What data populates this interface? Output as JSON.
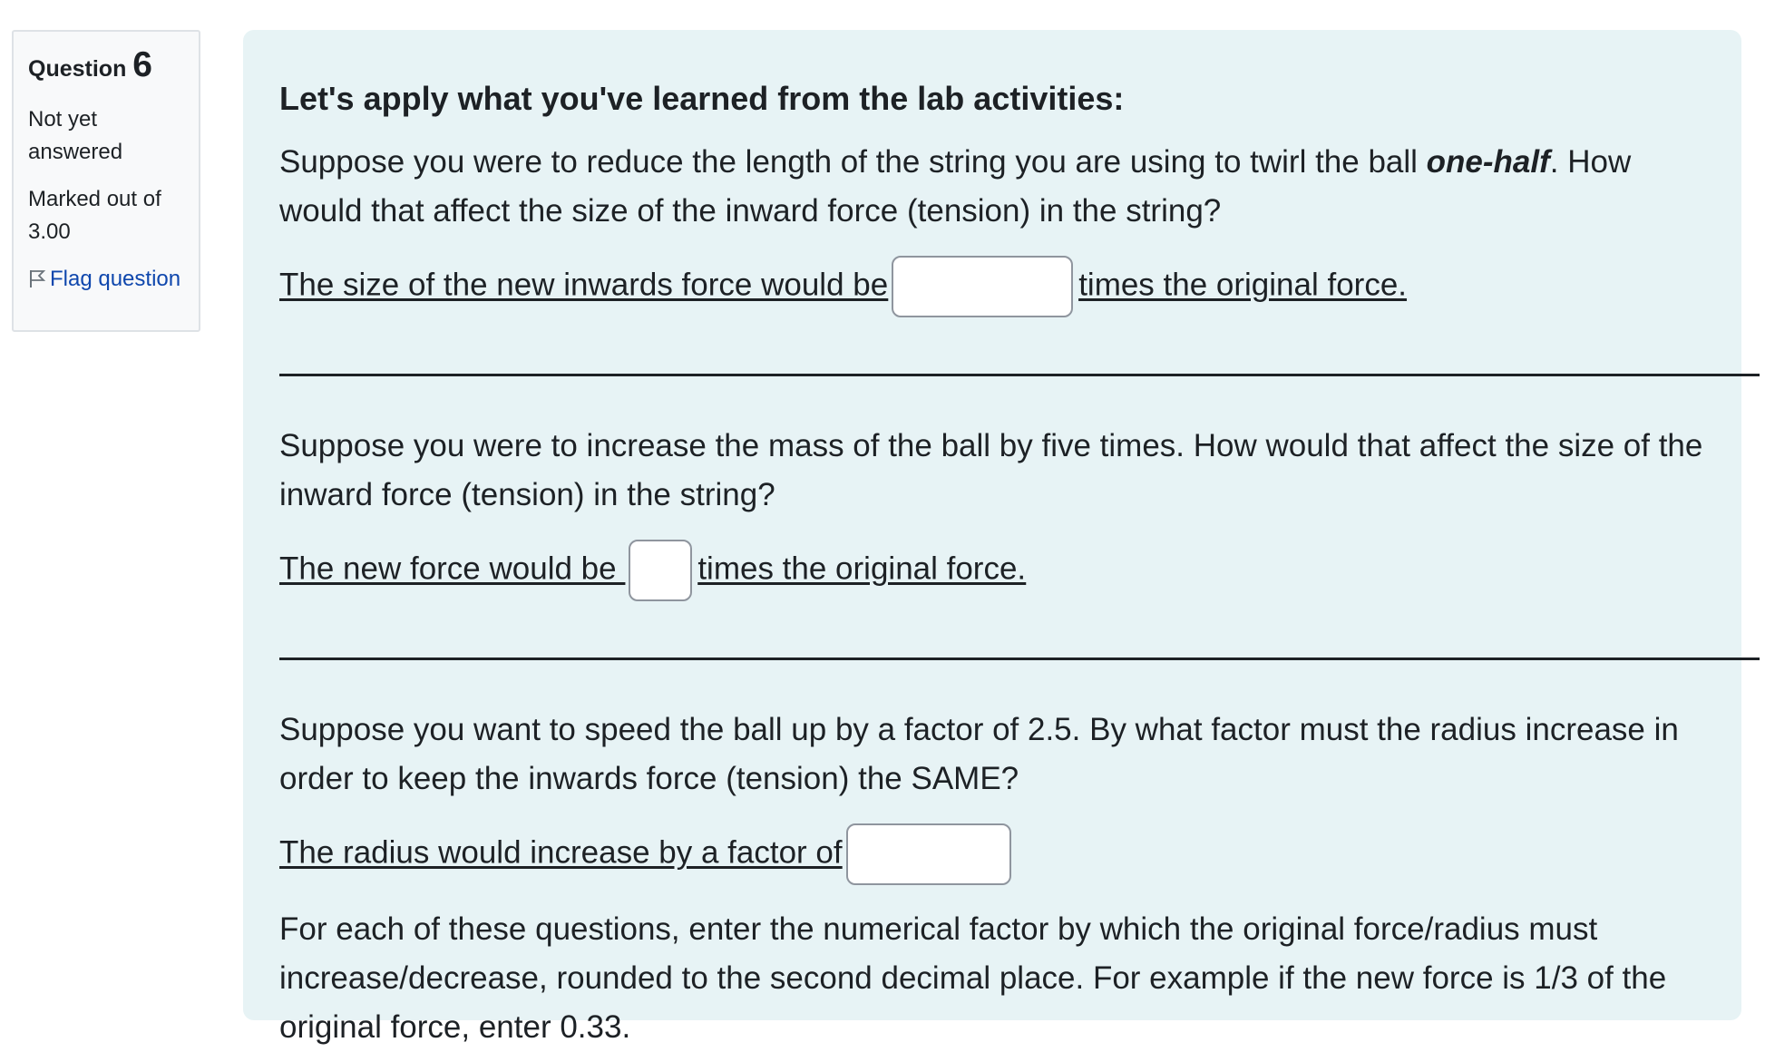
{
  "info": {
    "question_label": "Question",
    "question_number": "6",
    "state": "Not yet answered",
    "grade": "Marked out of 3.00",
    "flag_label": "Flag question"
  },
  "content": {
    "heading": "Let's apply what you've learned from the lab activities:",
    "q1": {
      "prompt_before": "Suppose you were to reduce the length of the string you are using to twirl the ball ",
      "prompt_emph": "one-half",
      "prompt_after": ". How would that affect the size of the inward force (tension) in the string?",
      "answer_before": "The size of the new inwards force would be",
      "answer_after": "times the original force. ",
      "value": ""
    },
    "q2": {
      "prompt": "Suppose you were to increase the mass of the ball by five times. How would that affect the size of the inward force (tension) in the string?",
      "answer_before": "The new force would be ",
      "answer_after": "times the original force.",
      "value": ""
    },
    "q3": {
      "prompt": "Suppose you want to speed the ball up by a factor of 2.5.  By what factor must the radius increase in order to keep the inwards force (tension) the SAME?",
      "answer_before": "The radius would increase by a factor of",
      "value": ""
    },
    "instructions": "For each of these questions, enter the numerical factor by which the original force/radius must increase/decrease, rounded to the second decimal place.  For example if the new force is 1/3 of the original force, enter 0.33."
  }
}
